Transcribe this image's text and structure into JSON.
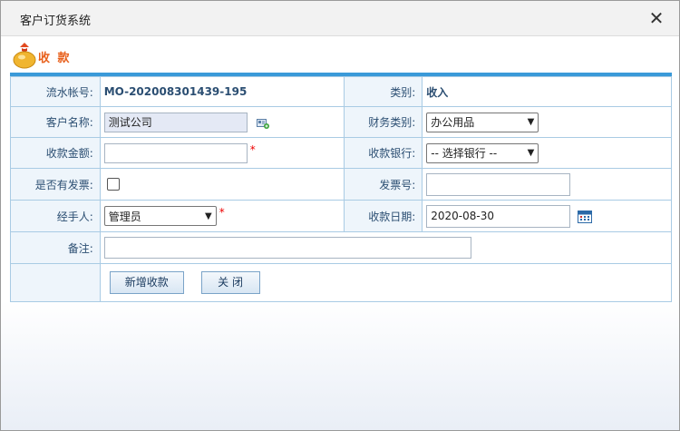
{
  "window": {
    "title": "客户订货系统"
  },
  "page": {
    "title": "收 款"
  },
  "form": {
    "serial_label": "流水帐号:",
    "serial_value": "MO-202008301439-195",
    "category_label": "类别:",
    "category_value": "收入",
    "customer_label": "客户名称:",
    "customer_value": "测试公司",
    "finance_type_label": "财务类别:",
    "finance_type_value": "办公用品",
    "amount_label": "收款金额:",
    "amount_value": "",
    "bank_label": "收款银行:",
    "bank_value": "-- 选择银行 --",
    "invoice_label": "是否有发票:",
    "invoice_checked": false,
    "invoice_no_label": "发票号:",
    "invoice_no_value": "",
    "handler_label": "经手人:",
    "handler_value": "管理员",
    "date_label": "收款日期:",
    "date_value": "2020-08-30",
    "note_label": "备注:",
    "note_value": "",
    "required_mark": "*"
  },
  "buttons": {
    "add_label": "新增收款",
    "close_label": "关 闭"
  },
  "colors": {
    "accent": "#3a9ad9",
    "title_orange": "#e8601c",
    "label_bg": "#eef5fb",
    "border": "#a9cbe4"
  },
  "icons": {
    "close": "close-icon",
    "header": "money-bag-icon",
    "customer_picker": "card-picker-icon",
    "date_picker": "calendar-icon"
  }
}
